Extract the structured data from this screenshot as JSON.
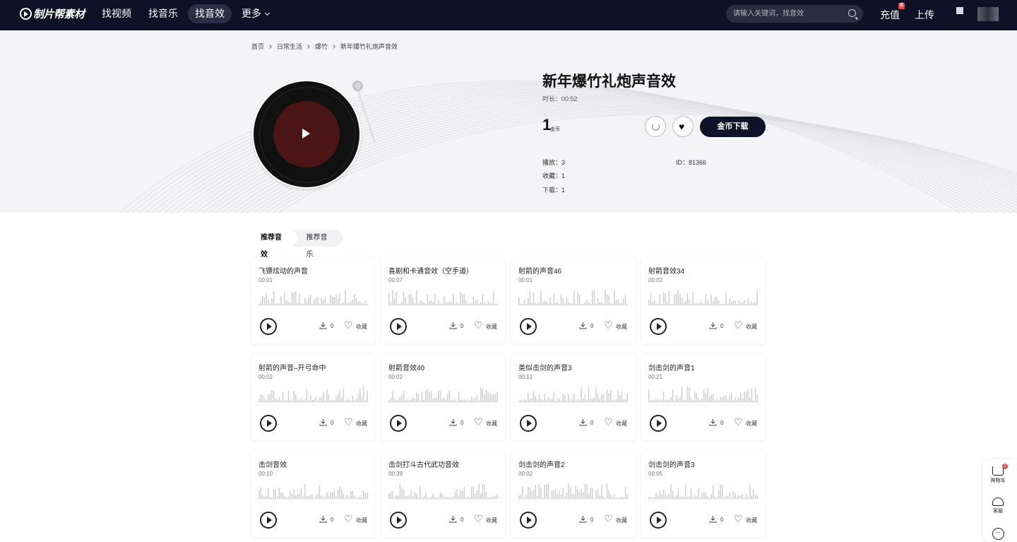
{
  "header": {
    "logo_text": "制片帮素材",
    "nav": [
      "找视频",
      "找音乐",
      "找音效",
      "更多"
    ],
    "active_nav": "找音效",
    "search_placeholder": "请输入关键词，找音效",
    "recharge_label": "充值",
    "recharge_badge": "惠",
    "upload_label": "上传"
  },
  "breadcrumb": [
    "首页",
    "日常生活",
    "爆竹",
    "新年爆竹礼炮声音效"
  ],
  "detail": {
    "title": "新年爆竹礼炮声音效",
    "duration_label": "时长：",
    "duration": "00:52",
    "price": "1",
    "price_unit": "金币",
    "download_button": "金币下载",
    "plays_label": "播放：",
    "plays": "3",
    "favorites_label": "收藏：",
    "favorites": "1",
    "downloads_label": "下载：",
    "downloads": "1",
    "id_label": "ID：",
    "id": "81366"
  },
  "tabs": [
    "推荐音效",
    "推荐音乐"
  ],
  "active_tab": "推荐音效",
  "cards": [
    {
      "title": "飞镖炫动的声音",
      "duration": "00:01",
      "downloads": "0",
      "fav_label": "收藏"
    },
    {
      "title": "喜剧和卡通音效（空手道）",
      "duration": "00:07",
      "downloads": "0",
      "fav_label": "收藏"
    },
    {
      "title": "射箭的声音46",
      "duration": "00:01",
      "downloads": "0",
      "fav_label": "收藏"
    },
    {
      "title": "射箭音效34",
      "duration": "00:02",
      "downloads": "0",
      "fav_label": "收藏"
    },
    {
      "title": "射箭的声音–开弓命中",
      "duration": "00:02",
      "downloads": "0",
      "fav_label": "收藏"
    },
    {
      "title": "射箭音效40",
      "duration": "00:02",
      "downloads": "0",
      "fav_label": "收藏"
    },
    {
      "title": "类似击剑的声音3",
      "duration": "00:12",
      "downloads": "0",
      "fav_label": "收藏"
    },
    {
      "title": "剑击剑的声音1",
      "duration": "00:21",
      "downloads": "0",
      "fav_label": "收藏"
    },
    {
      "title": "击剑音效",
      "duration": "00:10",
      "downloads": "0",
      "fav_label": "收藏"
    },
    {
      "title": "击剑打斗古代武功音效",
      "duration": "00:39",
      "downloads": "0",
      "fav_label": "收藏"
    },
    {
      "title": "剑击剑的声音2",
      "duration": "00:02",
      "downloads": "0",
      "fav_label": "收藏"
    },
    {
      "title": "剑击剑的声音3",
      "duration": "00:05",
      "downloads": "0",
      "fav_label": "收藏"
    }
  ],
  "side": {
    "cart_label": "购物车",
    "cart_count": "2",
    "service_label": "客服",
    "chat_icon_glyph": "···"
  },
  "icons": [
    "logo-icon",
    "chevron-down-icon",
    "search-icon",
    "message-icon",
    "refresh-icon",
    "heart-icon",
    "play-icon",
    "download-icon",
    "cart-icon",
    "headset-icon",
    "chat-icon"
  ],
  "colors": {
    "header_bg": "#0f1126",
    "accent_button": "#10122a",
    "disc_label": "#4a1514",
    "badge": "#e04b4b"
  }
}
